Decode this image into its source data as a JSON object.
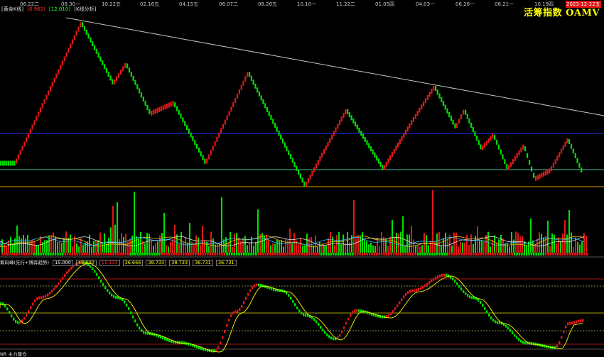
{
  "header": {
    "dates": [
      "06.22二",
      "08.30一",
      "10.22五",
      "02.16五",
      "04.15五",
      "06.07二",
      "08.26五",
      "10.10一",
      "11.22二",
      "01.05四",
      "04.03一",
      "06.26一",
      "08.21一",
      "10.19四"
    ],
    "end_date": "2023-12-22五",
    "title": "活筹指数 OAMV"
  },
  "price_panel": {
    "legend_name": "[黄金K线]",
    "legend_v1": "[6.962]",
    "legend_v2": "[12.010]",
    "legend_v3": "[K线分析]"
  },
  "indicator_panel": {
    "name": "筹码峰(先行+博弈趋势)",
    "values": [
      "15.000",
      "45.000",
      "11.133",
      "36.666",
      "38.733",
      "38.733",
      "36.731",
      "36.731"
    ],
    "value_colors": [
      "#ffffff",
      "#ffff00",
      "#ff3030",
      "#ffff00",
      "#ffff00",
      "#ffff00",
      "#ffff00",
      "#ffff00"
    ]
  },
  "bottom_label": "NR 主力建仓",
  "colors": {
    "up": "#e01818",
    "down": "#00e000",
    "trendline": "#c8c8c8",
    "blue_line": "#2030ff",
    "teal_line": "#40c0a0",
    "orange_line": "#e0a000",
    "yellow_curve": "#ffff00"
  }
}
